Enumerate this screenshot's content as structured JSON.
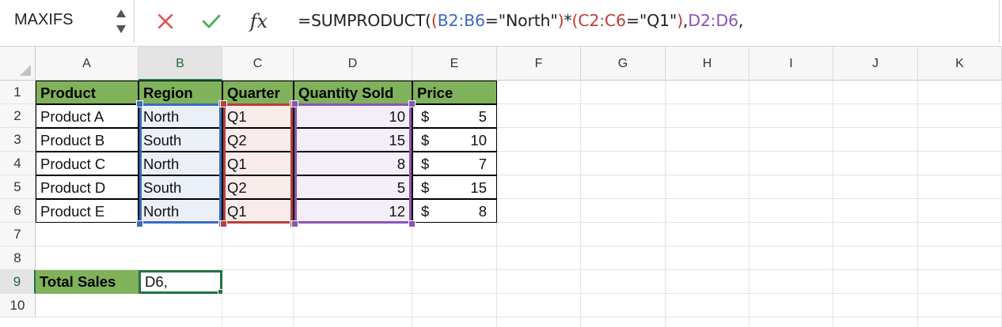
{
  "formula_bar": {
    "name_box": "MAXIFS",
    "cancel_icon": "cancel-x-icon",
    "enter_icon": "checkmark-icon",
    "fx_label": "fx",
    "formula_parts": [
      {
        "text": "=SUMPRODUCT(",
        "color": "#222222"
      },
      {
        "text": "(",
        "color": "#c0392b"
      },
      {
        "text": "B2:B6",
        "color": "#3c6bbf"
      },
      {
        "text": "=\"North\"",
        "color": "#222222"
      },
      {
        "text": ")",
        "color": "#c0392b"
      },
      {
        "text": "*",
        "color": "#222222"
      },
      {
        "text": "(",
        "color": "#c0392b"
      },
      {
        "text": "C2:C6",
        "color": "#b8403a"
      },
      {
        "text": "=\"Q1\"",
        "color": "#222222"
      },
      {
        "text": ")",
        "color": "#c0392b"
      },
      {
        "text": ",",
        "color": "#222222"
      },
      {
        "text": "D2:D6",
        "color": "#8a55b5"
      },
      {
        "text": ",",
        "color": "#222222"
      }
    ]
  },
  "columns": [
    "A",
    "B",
    "C",
    "D",
    "E",
    "F",
    "G",
    "H",
    "I",
    "J",
    "K"
  ],
  "active_column": "B",
  "rows": [
    "1",
    "2",
    "3",
    "4",
    "5",
    "6",
    "7",
    "8",
    "9",
    "10"
  ],
  "active_row": "9",
  "table": {
    "headers": [
      "Product",
      "Region",
      "Quarter",
      "Quantity Sold",
      "Price"
    ],
    "data": [
      {
        "product": "Product A",
        "region": "North",
        "quarter": "Q1",
        "qty": "10",
        "currency": "$",
        "price": "5"
      },
      {
        "product": "Product B",
        "region": "South",
        "quarter": "Q2",
        "qty": "15",
        "currency": "$",
        "price": "10"
      },
      {
        "product": "Product C",
        "region": "North",
        "quarter": "Q1",
        "qty": "8",
        "currency": "$",
        "price": "7"
      },
      {
        "product": "Product D",
        "region": "South",
        "quarter": "Q2",
        "qty": "5",
        "currency": "$",
        "price": "15"
      },
      {
        "product": "Product E",
        "region": "North",
        "quarter": "Q1",
        "qty": "12",
        "currency": "$",
        "price": "8"
      }
    ]
  },
  "total": {
    "label": "Total Sales",
    "edit_value": "D6,"
  },
  "colors": {
    "header_green": "#7fb25b",
    "range_blue": "#3c6bbf",
    "range_red": "#b8403a",
    "range_purple": "#8a55b5",
    "active_green": "#217346"
  }
}
